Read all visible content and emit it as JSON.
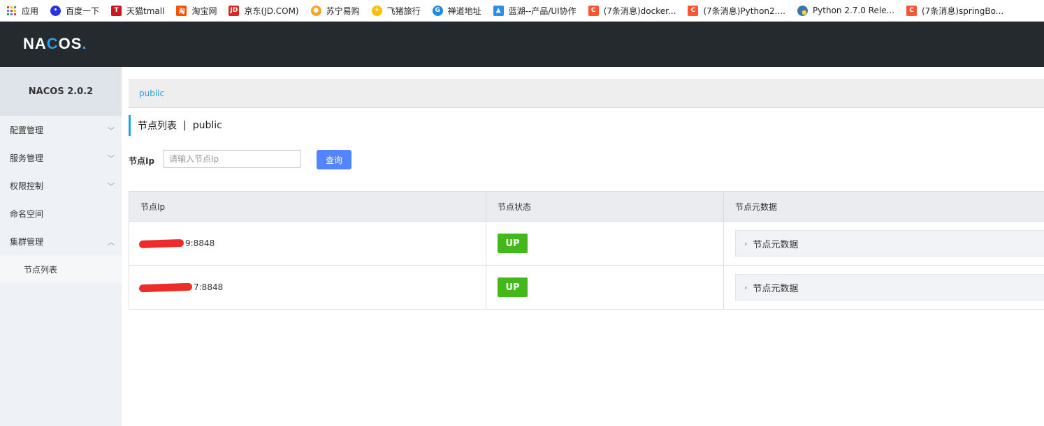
{
  "bookmarks": [
    {
      "label": "应用",
      "icon": "apps-grid-icon",
      "color": "#e94235"
    },
    {
      "label": "百度一下",
      "icon": "baidu-paw-icon",
      "color": "#2932e1"
    },
    {
      "label": "天猫tmall",
      "icon": "tmall-icon",
      "color": "#c81623"
    },
    {
      "label": "淘宝网",
      "icon": "taobao-icon",
      "color": "#ff5000"
    },
    {
      "label": "京东(JD.COM)",
      "icon": "jd-icon",
      "color": "#e1251b"
    },
    {
      "label": "苏宁易购",
      "icon": "suning-icon",
      "color": "#f5a623"
    },
    {
      "label": "飞猪旅行",
      "icon": "fliggy-icon",
      "color": "#ffbf00"
    },
    {
      "label": "禅道地址",
      "icon": "zentao-icon",
      "color": "#1e88e5"
    },
    {
      "label": "蓝湖--产品/UI协作",
      "icon": "lanhu-icon",
      "color": "#2d8cf0"
    },
    {
      "label": "(7条消息)docker...",
      "icon": "csdn-icon",
      "color": "#fc5531"
    },
    {
      "label": "(7条消息)Python2....",
      "icon": "csdn-icon",
      "color": "#fc5531"
    },
    {
      "label": "Python 2.7.0 Rele...",
      "icon": "python-icon",
      "color": "#3776ab"
    },
    {
      "label": "(7条消息)springBo...",
      "icon": "csdn-icon",
      "color": "#fc5531"
    }
  ],
  "header": {
    "logo_text_a": "NA",
    "logo_text_b": "C",
    "logo_text_c": "OS",
    "logo_dot": "."
  },
  "sidebar": {
    "title": "NACOS 2.0.2",
    "items": [
      {
        "label": "配置管理",
        "chevron": "﹀"
      },
      {
        "label": "服务管理",
        "chevron": "﹀"
      },
      {
        "label": "权限控制",
        "chevron": "﹀"
      },
      {
        "label": "命名空间",
        "chevron": ""
      },
      {
        "label": "集群管理",
        "chevron": "︿"
      }
    ],
    "sub_items": [
      {
        "label": "节点列表"
      }
    ]
  },
  "main": {
    "namespace": "public",
    "title": "节点列表",
    "title_sep": "|",
    "title_ns": "public",
    "search": {
      "label": "节点Ip",
      "placeholder": "请输入节点Ip",
      "value": "",
      "button": "查询"
    },
    "table": {
      "headers": [
        "节点Ip",
        "节点状态",
        "节点元数据"
      ],
      "rows": [
        {
          "ip_suffix": "9:8848",
          "status": "UP",
          "metadata": "节点元数据"
        },
        {
          "ip_suffix": "7:8848",
          "status": "UP",
          "metadata": "节点元数据"
        }
      ]
    }
  },
  "colors": {
    "accent": "#1fa2e0",
    "status_up": "#42b819",
    "button": "#5584ff",
    "header_bg": "#252a2f"
  }
}
